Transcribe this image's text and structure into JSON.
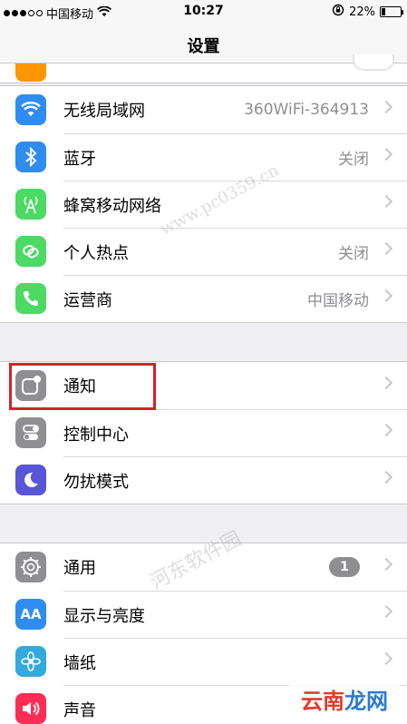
{
  "status": {
    "carrier": "中国移动",
    "time": "10:27",
    "battery_text": "22%",
    "battery_level": 0.22
  },
  "nav": {
    "title": "设置"
  },
  "groups": [
    {
      "rows": [
        {
          "label": "无线局域网",
          "value": "360WiFi-364913",
          "icon": "wifi-icon",
          "color": "#2f8cf0"
        },
        {
          "label": "蓝牙",
          "value": "关闭",
          "icon": "bluetooth-icon",
          "color": "#2f8cf0"
        },
        {
          "label": "蜂窝移动网络",
          "value": "",
          "icon": "cellular-antenna-icon",
          "color": "#4cd964"
        },
        {
          "label": "个人热点",
          "value": "关闭",
          "icon": "hotspot-link-icon",
          "color": "#4cd964"
        },
        {
          "label": "运营商",
          "value": "中国移动",
          "icon": "phone-icon",
          "color": "#4cd964"
        }
      ]
    },
    {
      "rows": [
        {
          "label": "通知",
          "value": "",
          "icon": "notifications-icon",
          "color": "#8e8e93"
        },
        {
          "label": "控制中心",
          "value": "",
          "icon": "toggles-icon",
          "color": "#8e8e93"
        },
        {
          "label": "勿扰模式",
          "value": "",
          "icon": "moon-icon",
          "color": "#5856d6"
        }
      ]
    },
    {
      "rows": [
        {
          "label": "通用",
          "value": "",
          "badge": "1",
          "icon": "gear-icon",
          "color": "#8e8e93"
        },
        {
          "label": "显示与亮度",
          "value": "",
          "icon": "text-size-icon",
          "color": "#2f8cf0",
          "glyph": "AA"
        },
        {
          "label": "墙纸",
          "value": "",
          "icon": "flower-icon",
          "color": "#34aadc"
        },
        {
          "label": "声音",
          "value": "",
          "icon": "speaker-icon",
          "color": "#ff2d55"
        }
      ]
    }
  ],
  "watermark": {
    "text": "河东软件园",
    "url": "www.pc0359.cn",
    "logo": [
      "云南",
      "龙网"
    ]
  }
}
